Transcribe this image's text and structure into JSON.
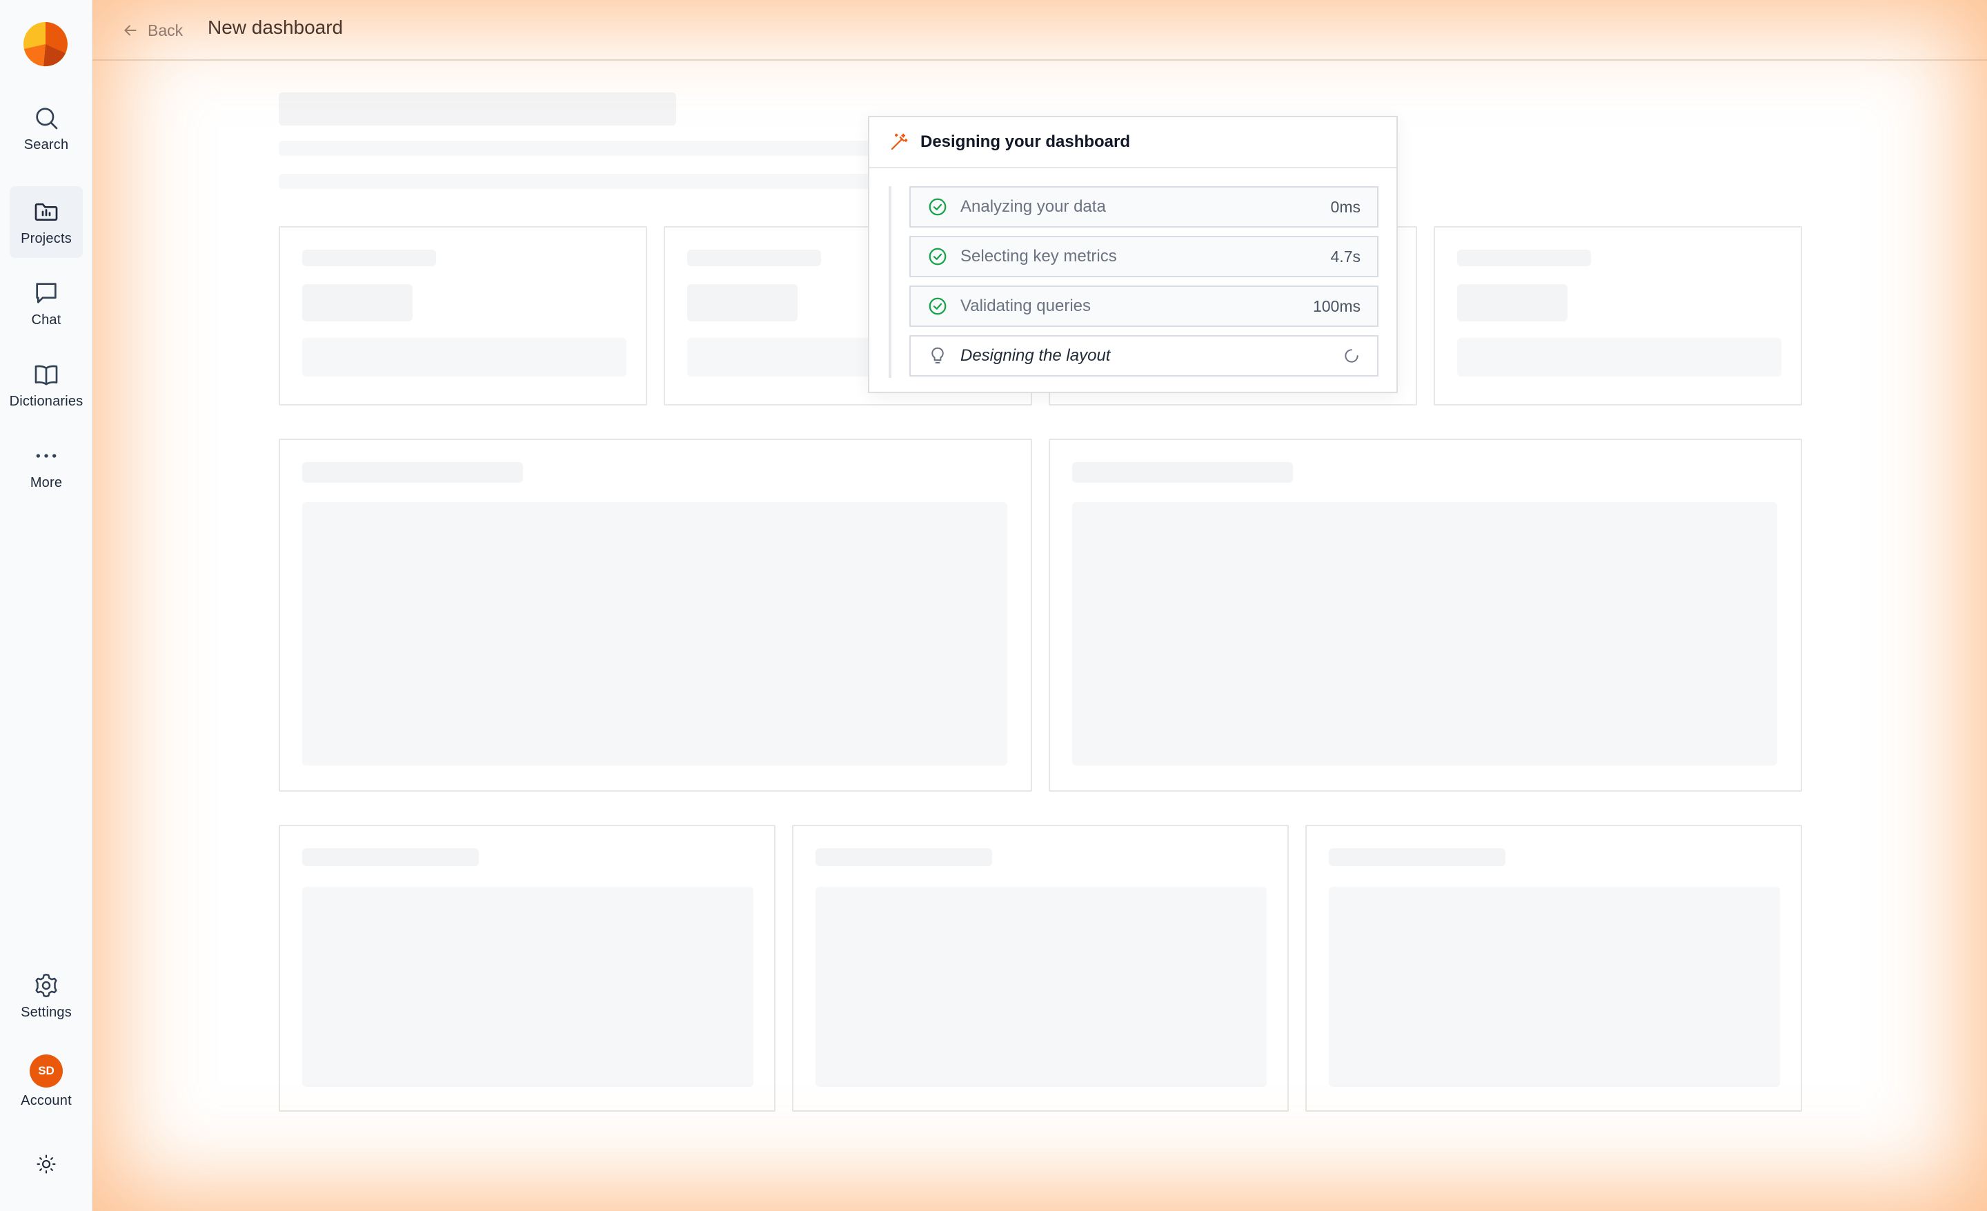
{
  "sidebar": {
    "logo": "app-logo",
    "items": [
      {
        "label": "Search",
        "icon": "search-icon"
      },
      {
        "label": "Projects",
        "icon": "folder-chart-icon",
        "active": true
      },
      {
        "label": "Chat",
        "icon": "chat-bubble-icon"
      },
      {
        "label": "Dictionaries",
        "icon": "book-open-icon"
      },
      {
        "label": "More",
        "icon": "more-dots-icon"
      }
    ],
    "settings_label": "Settings",
    "account_label": "Account",
    "account_initials": "SD",
    "theme_icon": "sun-icon"
  },
  "header": {
    "back_label": "Back",
    "title": "New dashboard"
  },
  "modal": {
    "title": "Designing your dashboard",
    "steps": [
      {
        "label": "Analyzing your data",
        "time": "0ms",
        "status": "done"
      },
      {
        "label": "Selecting key metrics",
        "time": "4.7s",
        "status": "done"
      },
      {
        "label": "Validating queries",
        "time": "100ms",
        "status": "done"
      },
      {
        "label": "Designing the layout",
        "time": "",
        "status": "in-progress"
      }
    ]
  },
  "colors": {
    "accent": "#ea580c",
    "success": "#16a34a",
    "glow": "#fb923c"
  }
}
